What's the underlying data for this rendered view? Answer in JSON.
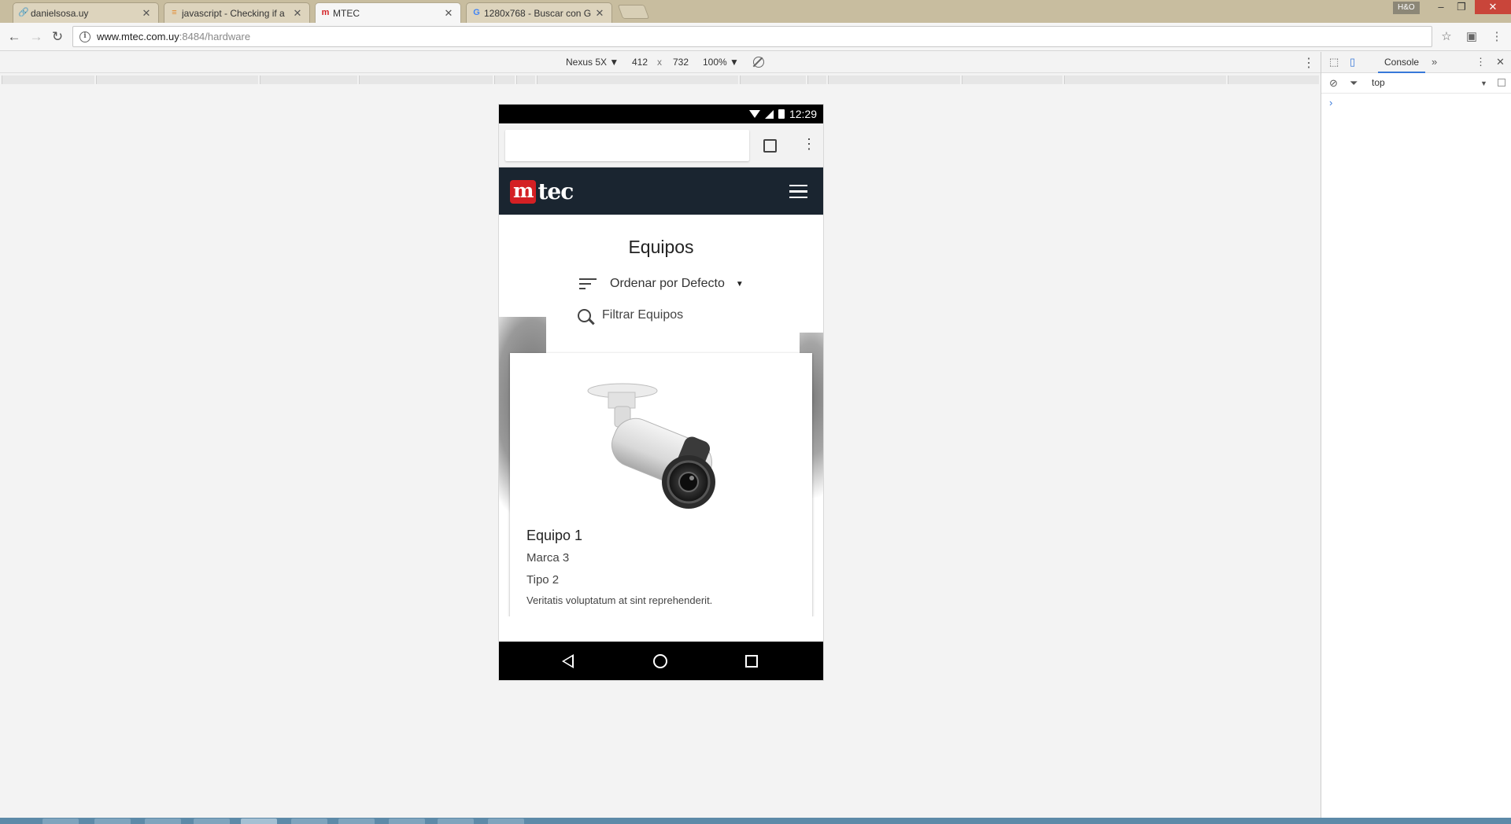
{
  "browser": {
    "tabs": [
      {
        "label": "danielsosa.uy",
        "icon": "link-icon"
      },
      {
        "label": "javascript - Checking if a",
        "icon": "stackoverflow-icon"
      },
      {
        "label": "MTEC",
        "icon": "mtec-icon"
      },
      {
        "label": "1280x768 - Buscar con G",
        "icon": "google-icon"
      }
    ],
    "profile_label": "H&O",
    "url_host": "www.mtec.com.uy",
    "url_path": ":8484/hardware",
    "tab_close_glyph": "✕"
  },
  "device_toolbar": {
    "device": "Nexus 5X ▼",
    "width": "412",
    "times": "x",
    "height": "732",
    "zoom": "100% ▼"
  },
  "devtools": {
    "tab_label": "Console",
    "more_label": "»",
    "context": "top",
    "prompt": "›"
  },
  "phone": {
    "time": "12:29"
  },
  "site": {
    "logo_m": "m",
    "logo_tec": "tec",
    "page_title": "Equipos",
    "sort_label": "Ordenar por Defecto",
    "sort_caret": "▼",
    "filter_placeholder": "Filtrar Equipos"
  },
  "product": {
    "name": "Equipo 1",
    "brand": "Marca 3",
    "type": "Tipo 2",
    "description": "Veritatis voluptatum at sint reprehenderit.",
    "image": "security-camera-image"
  },
  "colors": {
    "site_nav": "#1a2530",
    "brand_red": "#d42024",
    "devtools_accent": "#3879d9",
    "chrome_frame": "#c8bd9f"
  }
}
